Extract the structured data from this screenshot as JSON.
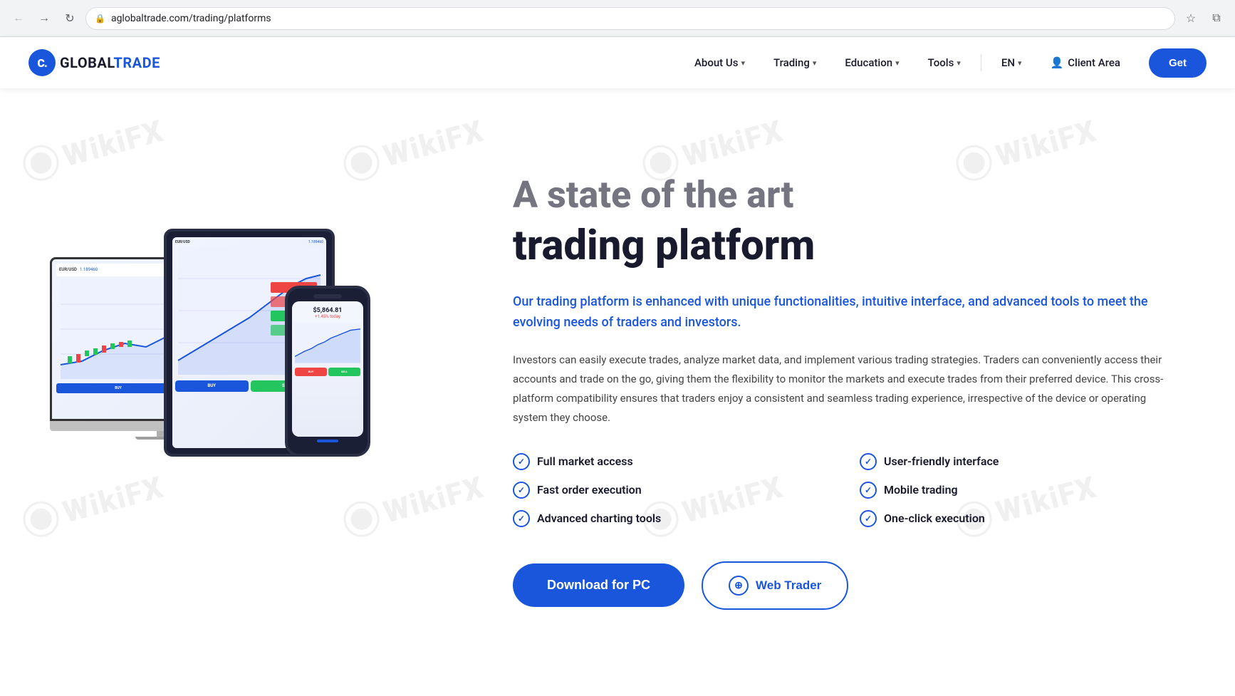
{
  "browser": {
    "url": "aglobaltrade.com/trading/platforms",
    "back_label": "←",
    "forward_label": "→",
    "reload_label": "↻",
    "star_label": "☆",
    "tab_label": "⧉"
  },
  "navbar": {
    "logo_text": "C. GLOBALTRADE",
    "logo_letter": "C",
    "links": [
      {
        "label": "About Us",
        "has_dropdown": true
      },
      {
        "label": "Trading",
        "has_dropdown": true
      },
      {
        "label": "Education",
        "has_dropdown": true
      },
      {
        "label": "Tools",
        "has_dropdown": true
      },
      {
        "label": "EN",
        "has_dropdown": true
      }
    ],
    "client_area_label": "Client Area",
    "get_button_label": "Get"
  },
  "hero": {
    "heading_partial": "A state of the art",
    "heading_main": "trading platform",
    "subtitle": "Our trading platform is enhanced with unique functionalities, intuitive interface, and advanced tools to meet the evolving needs of traders and investors.",
    "description": "Investors can easily execute trades, analyze market data, and implement various trading strategies. Traders can conveniently access their accounts and trade on the go, giving them the flexibility to monitor the markets and execute trades from their preferred device. This cross-platform compatibility ensures that traders enjoy a consistent and seamless trading experience, irrespective of the device or operating system they choose.",
    "features": [
      {
        "label": "Full market access"
      },
      {
        "label": "User-friendly interface"
      },
      {
        "label": "Fast order execution"
      },
      {
        "label": "Mobile trading"
      },
      {
        "label": "Advanced charting tools"
      },
      {
        "label": "One-click execution"
      }
    ],
    "download_btn_label": "Download for PC",
    "webtrader_btn_label": "Web Trader",
    "watermark_text": "WikiFX"
  },
  "device": {
    "ticker": "EUR/USD",
    "price": "1.189460",
    "phone_price": "$5,864.81",
    "phone_change": "+1.45% today"
  }
}
